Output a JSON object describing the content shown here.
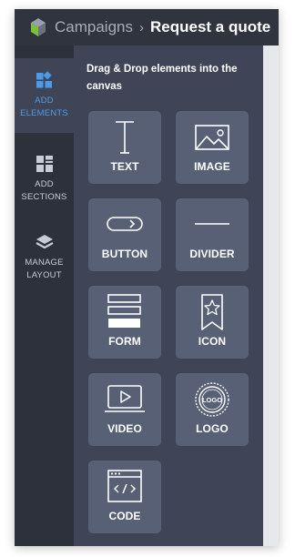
{
  "header": {
    "breadcrumb_parent": "Campaigns",
    "breadcrumb_separator": "›",
    "breadcrumb_current": "Request a quote"
  },
  "sidebar": {
    "items": [
      {
        "label": "ADD ELEMENTS",
        "icon": "add-elements-icon",
        "active": true
      },
      {
        "label": "ADD SECTIONS",
        "icon": "sections-grid-icon",
        "active": false
      },
      {
        "label": "MANAGE LAYOUT",
        "icon": "layers-icon",
        "active": false
      }
    ]
  },
  "panel": {
    "title": "Drag & Drop elements into the canvas",
    "elements": [
      {
        "label": "TEXT",
        "icon": "text-icon"
      },
      {
        "label": "IMAGE",
        "icon": "image-icon"
      },
      {
        "label": "BUTTON",
        "icon": "button-icon"
      },
      {
        "label": "DIVIDER",
        "icon": "divider-icon"
      },
      {
        "label": "FORM",
        "icon": "form-icon"
      },
      {
        "label": "ICON",
        "icon": "star-bookmark-icon"
      },
      {
        "label": "VIDEO",
        "icon": "video-icon"
      },
      {
        "label": "LOGO",
        "icon": "logo-badge-icon"
      },
      {
        "label": "CODE",
        "icon": "code-icon"
      }
    ],
    "logo_badge_text": "LOGO"
  },
  "colors": {
    "header_bg": "#30343f",
    "rail_bg": "#2d313c",
    "panel_bg": "#3f4556",
    "tile_bg": "#586076",
    "accent": "#4c9be8",
    "logo_green": "#7bbf3a"
  }
}
